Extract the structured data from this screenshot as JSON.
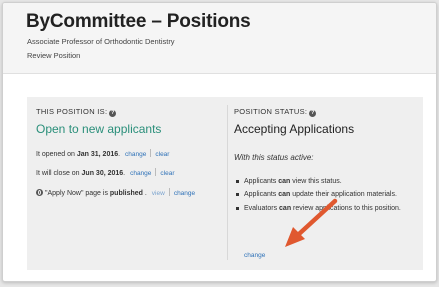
{
  "header": {
    "title": "ByCommittee – Positions",
    "subtitle": "Associate Professor of Orthodontic Dentistry",
    "breadcrumb": "Review Position"
  },
  "left": {
    "heading": "THIS POSITION IS:",
    "status": "Open to new applicants",
    "opened_prefix": "It opened on ",
    "opened_date": "Jan 31, 2016",
    "opened_suffix": ".",
    "close_prefix": "It will close on ",
    "close_date": "Jun 30, 2016",
    "close_suffix": ".",
    "change_label": "change",
    "clear_label": "clear",
    "apply_prefix": "\"Apply Now\" page is ",
    "apply_state": "published",
    "apply_suffix": " .",
    "view_label": "view"
  },
  "right": {
    "heading": "POSITION STATUS:",
    "status": "Accepting Applications",
    "with_status": "With this status active:",
    "bullets": [
      {
        "pre": "Applicants ",
        "bold": "can",
        "post": " view this status."
      },
      {
        "pre": "Applicants ",
        "bold": "can",
        "post": " update their application materials."
      },
      {
        "pre": "Evaluators ",
        "bold": "can",
        "post": " review applications to this position."
      }
    ],
    "change_label": "change"
  },
  "annotation": {
    "arrow_color": "#e0582f"
  },
  "icons": {
    "info": "info-circle-icon",
    "globe": "globe-icon"
  }
}
